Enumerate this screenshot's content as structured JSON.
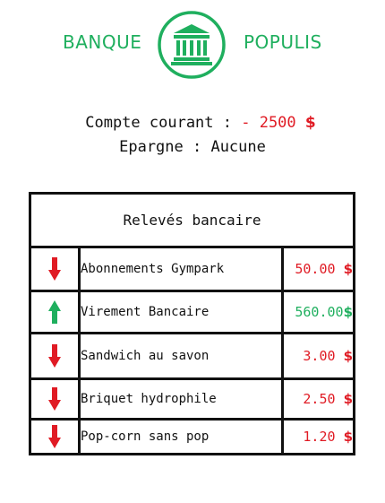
{
  "brand": {
    "left": "BANQUE",
    "right": "POPULIS",
    "color": "#1faf5e"
  },
  "logo_icon": "bank-building-icon",
  "summary": {
    "account_label": "Compte courant : ",
    "account_amount": "- 2500",
    "account_currency": "$",
    "savings_line": "Epargne : Aucune"
  },
  "statements": {
    "title": "Relevés bancaire",
    "rows": [
      {
        "direction": "down",
        "icon": "arrow-down-icon",
        "label": "Abonnements Gympark",
        "amount": "50.00 ",
        "currency": "$",
        "color": "#e01b24"
      },
      {
        "direction": "up",
        "icon": "arrow-up-icon",
        "label": "Virement Bancaire",
        "amount": "560.00",
        "currency": "$",
        "color": "#1faf5e"
      },
      {
        "direction": "down",
        "icon": "arrow-down-icon",
        "label": "Sandwich au savon",
        "amount": "3.00 ",
        "currency": "$",
        "color": "#e01b24"
      },
      {
        "direction": "down",
        "icon": "arrow-down-icon",
        "label": "Briquet hydrophile",
        "amount": "2.50 ",
        "currency": "$",
        "color": "#e01b24"
      },
      {
        "direction": "down",
        "icon": "arrow-down-icon",
        "label": "Pop-corn sans pop",
        "amount": "1.20 ",
        "currency": "$",
        "color": "#e01b24"
      }
    ]
  },
  "colors": {
    "negative": "#e01b24",
    "positive": "#1faf5e",
    "border": "#111111"
  }
}
